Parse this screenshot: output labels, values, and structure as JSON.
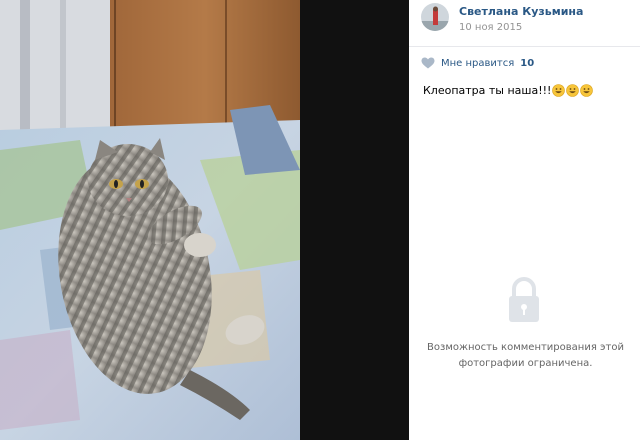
{
  "post": {
    "author_name": "Светлана Кузьмина",
    "date": "10 ноя 2015",
    "likes_label": "Мне нравится",
    "likes_count": "10",
    "caption": "Клеопатра ты наша!!!",
    "caption_emoji": [
      "grinning-face-emoji",
      "grinning-face-emoji",
      "grinning-face-emoji"
    ]
  },
  "comments": {
    "restricted_text": "Возможность комментирования этой фотографии ограничена."
  },
  "colors": {
    "link": "#2a5885",
    "muted": "#939393",
    "restricted": "#656565"
  },
  "icons": {
    "like": "heart-icon",
    "lock": "lock-icon"
  }
}
